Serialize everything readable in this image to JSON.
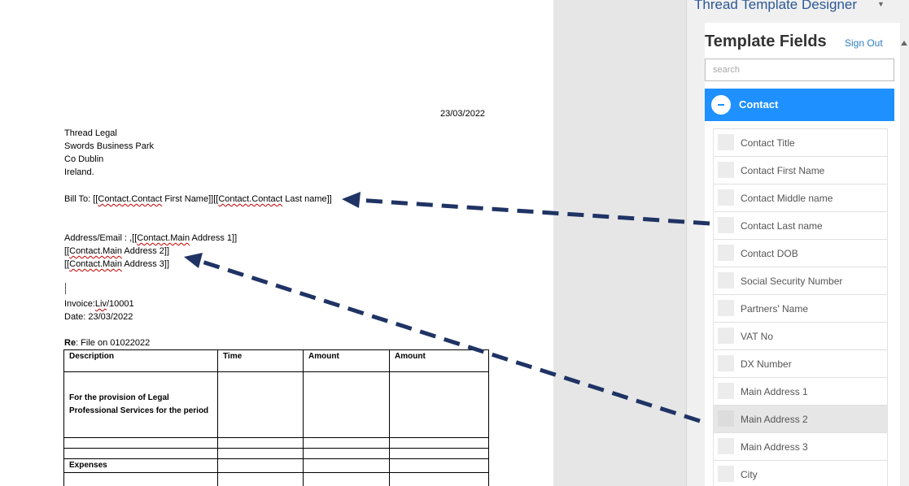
{
  "document": {
    "date": "23/03/2022",
    "sender_address": [
      "Thread Legal",
      "Swords Business Park",
      "Co Dublin",
      "Ireland."
    ],
    "bill_to": {
      "prefix": "Bill To: [[",
      "part1": "Contact.Contact",
      "mid1": " First Name]][[",
      "part2": "Contact.Contact",
      "suffix": " Last name]]"
    },
    "address_line1": {
      "prefix": " Address/Email : ,[[",
      "token": "Contact.Main",
      "suffix": " Address 1]]"
    },
    "address_line2": {
      "prefix": "[[",
      "token": "Contact.Main",
      "suffix": " Address 2]]"
    },
    "address_line3": {
      "prefix": "[[",
      "token": "Contact.Main",
      "suffix": " Address 3]]"
    },
    "invoice": {
      "prefix": "Invoice:",
      "token": "Liv",
      "suffix": "/10001"
    },
    "invoice_date": "Date: 23/03/2022",
    "re": {
      "label": "Re",
      "text": ": File on 01022022"
    },
    "table": {
      "headers": [
        "Description",
        "Time",
        "Amount",
        "Amount"
      ],
      "row1": "For the provision of Legal Professional Services for the period",
      "expenses_label": "Expenses"
    }
  },
  "panel": {
    "title": "Thread Template Designer",
    "fields_title": "Template Fields",
    "sign_out": "Sign Out",
    "search_placeholder": "search",
    "group_label": "Contact",
    "fields": [
      "Contact Title",
      "Contact First Name",
      "Contact Middle name",
      "Contact Last name",
      "Contact DOB",
      "Social Security Number",
      "Partners' Name",
      "VAT No",
      "DX Number",
      "Main Address 1",
      "Main Address 2",
      "Main Address 3",
      "City"
    ],
    "selected_field": "Main Address 2"
  },
  "colors": {
    "accent_blue": "#1e90ff",
    "link_blue": "#2f7ec6",
    "title_blue": "#2b5797",
    "arrow_navy": "#1f3364",
    "spell_squiggle": "#c00000"
  },
  "icons": {
    "collapse": "minus-circle-icon",
    "menu": "chevron-down-icon",
    "scroll": "triangle-up-icon"
  }
}
